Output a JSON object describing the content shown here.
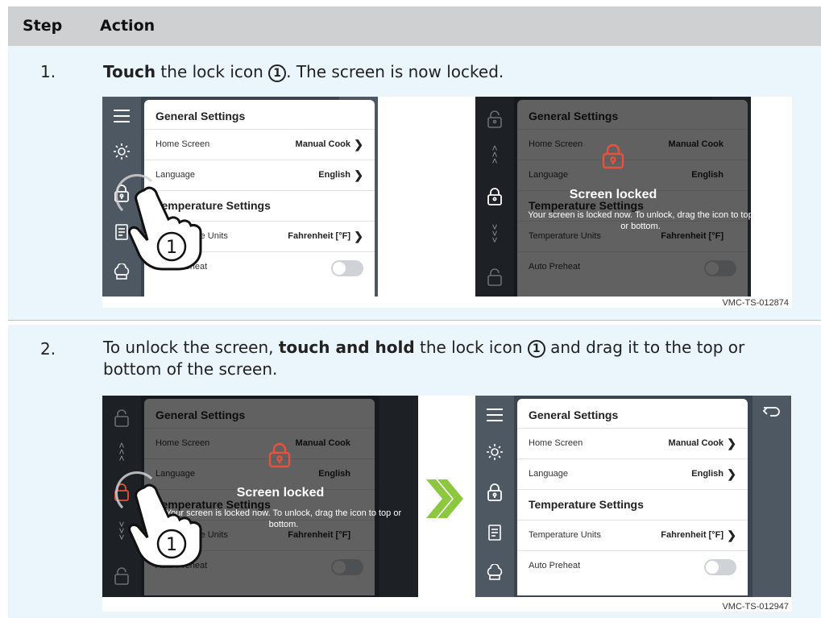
{
  "table": {
    "col_step": "Step",
    "col_action": "Action"
  },
  "steps": [
    {
      "num": "1.",
      "bold": "Touch",
      "text_a": " the lock icon ",
      "marker": "1",
      "text_b": ". The screen is now locked.",
      "figure_id": "VMC-TS-012874"
    },
    {
      "num": "2.",
      "text_pre": "To unlock the screen, ",
      "bold": "touch and hold",
      "text_a": " the lock icon ",
      "marker": "1",
      "text_b": " and drag it to the top or bottom of the screen.",
      "figure_id": "VMC-TS-012947"
    }
  ],
  "settings": {
    "general_title": "General Settings",
    "home_screen_label": "Home Screen",
    "home_screen_value": "Manual Cook",
    "language_label": "Language",
    "language_value": "English",
    "temperature_title": "Temperature Settings",
    "temp_units_label": "Temperature Units",
    "temp_units_value": "Fahrenheit [°F]",
    "auto_preheat_label": "Auto Preheat",
    "auto_preheat_on": false
  },
  "lock_overlay": {
    "title": "Screen locked",
    "message": "Your screen is locked now. To unlock, drag the icon to top or bottom."
  },
  "colors": {
    "header_bg": "#cfd0d1",
    "row_bg": "#eaf5fc",
    "lock_accent": "#e8523a",
    "arrow_green": "#8dc63f"
  },
  "icons": [
    "menu-icon",
    "brightness-icon",
    "lock-icon",
    "recipe-book-icon",
    "chef-hat-icon",
    "back-arrow-icon",
    "unlock-icon",
    "chevron-icon",
    "hand-pointer-icon"
  ]
}
